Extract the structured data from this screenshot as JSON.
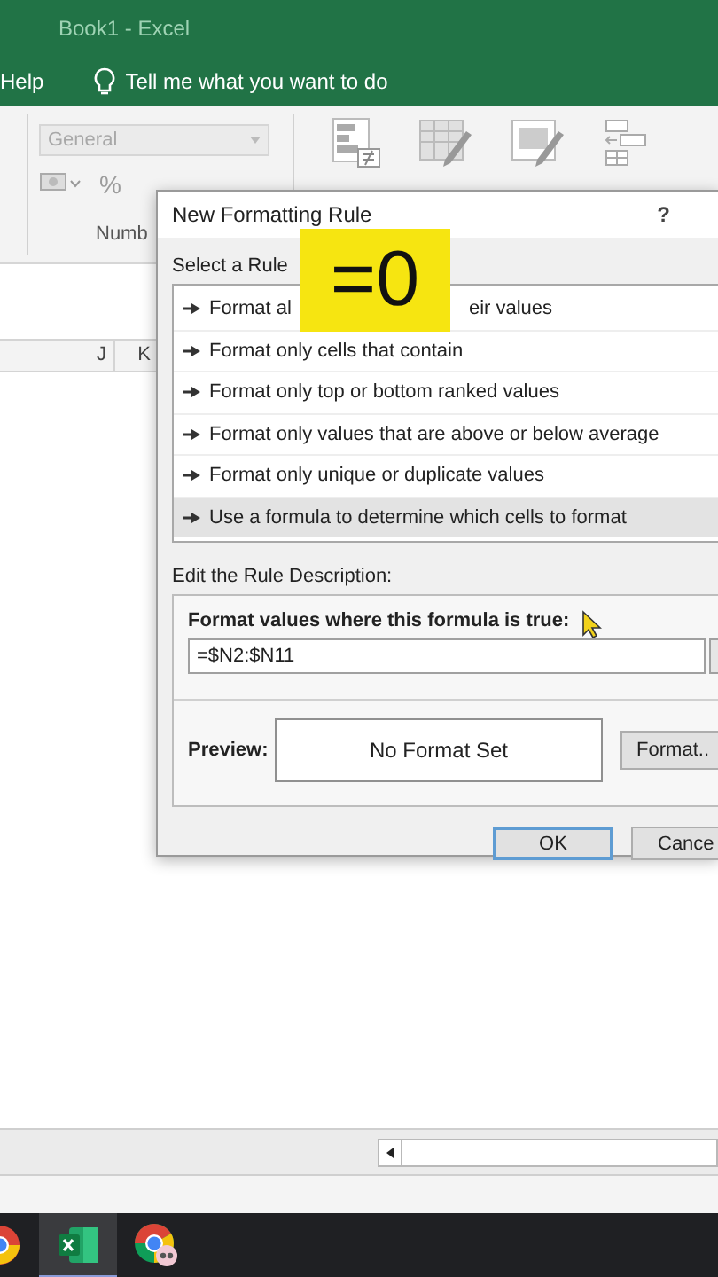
{
  "window": {
    "title": "Book1 - Excel"
  },
  "menu": {
    "help": "Help",
    "tell_me": "Tell me what you want to do"
  },
  "ribbon": {
    "number_format": "General",
    "percent": "%",
    "group_label": "Numb"
  },
  "columns": [
    "J",
    "K"
  ],
  "dialog": {
    "title": "New Formatting Rule",
    "help": "?",
    "overlay": "=0",
    "select_label": "Select a Rule",
    "rules": [
      {
        "parts": [
          "Format al",
          "eir values"
        ],
        "selected": false
      },
      {
        "parts": [
          "Format only cells that contain"
        ],
        "selected": false
      },
      {
        "parts": [
          "Format only top or bottom ranked values"
        ],
        "selected": false
      },
      {
        "parts": [
          "Format only values that are above or below average"
        ],
        "selected": false
      },
      {
        "parts": [
          "Format only unique or duplicate values"
        ],
        "selected": false
      },
      {
        "parts": [
          "Use a formula to determine which cells to format"
        ],
        "selected": true
      }
    ],
    "edit_label": "Edit the Rule Description:",
    "formula_label": "Format values where this formula is true:",
    "formula": "=$N2:$N11",
    "preview_label": "Preview:",
    "preview": "No Format Set",
    "format_button": "Format..",
    "ok": "OK",
    "cancel": "Cance"
  },
  "taskbar": [
    {
      "kind": "chrome",
      "selected": false
    },
    {
      "kind": "excel",
      "selected": true
    },
    {
      "kind": "chrome-profile",
      "selected": false
    }
  ]
}
